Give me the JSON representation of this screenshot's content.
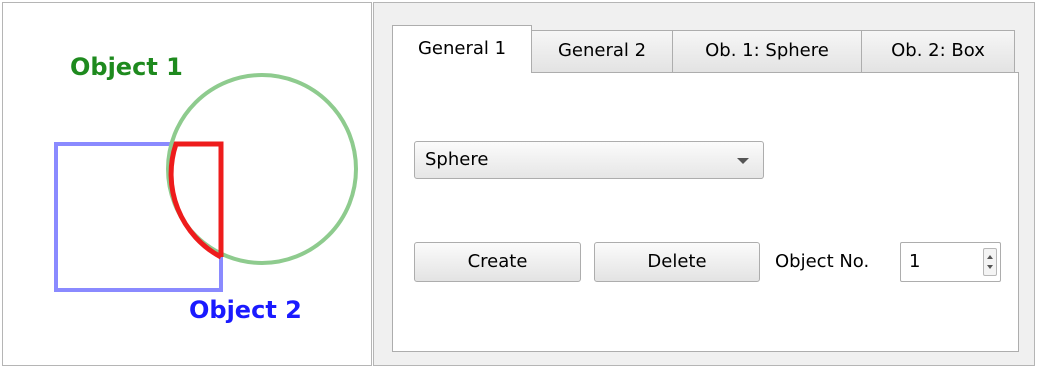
{
  "diagram": {
    "object1_label": "Object 1",
    "object2_label": "Object 2",
    "colors": {
      "object1": "#1e8a1e",
      "object1_outline": "#8ecb8e",
      "object2": "#1a1aff",
      "object2_outline": "#8a8aff",
      "intersection": "#ee1c1c"
    }
  },
  "tabs": [
    {
      "label": "General 1",
      "active": true
    },
    {
      "label": "General 2",
      "active": false
    },
    {
      "label": "Ob. 1: Sphere",
      "active": false
    },
    {
      "label": "Ob. 2: Box",
      "active": false
    }
  ],
  "panel": {
    "object_type": {
      "selected": "Sphere"
    },
    "create_label": "Create",
    "delete_label": "Delete",
    "object_no_label": "Object No.",
    "object_no_value": "1"
  }
}
